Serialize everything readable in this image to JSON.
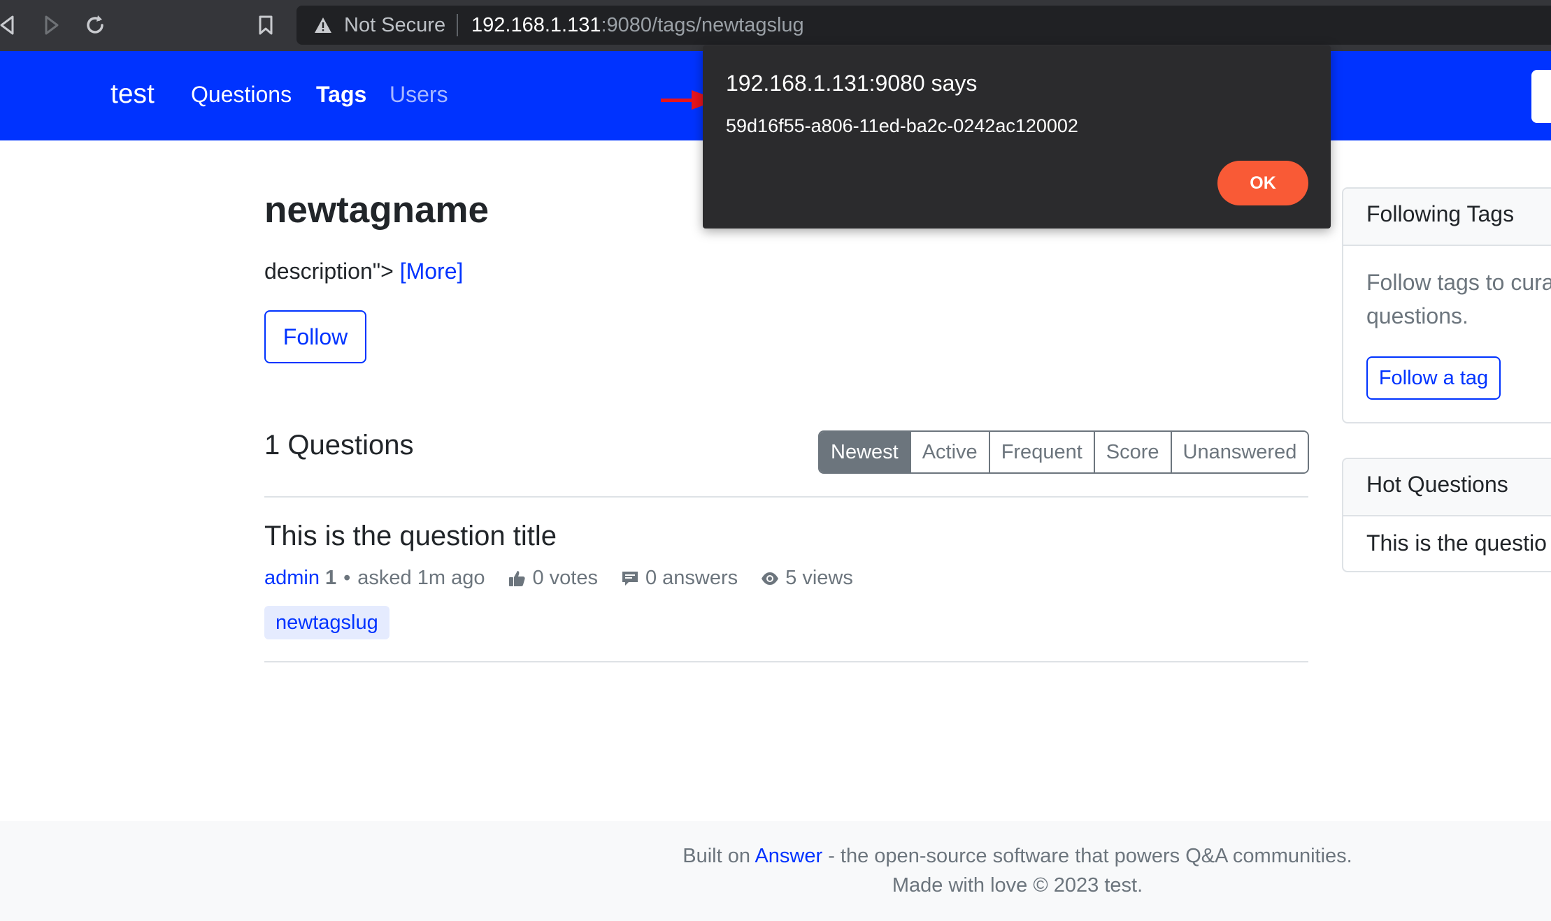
{
  "browser": {
    "security_label": "Not Secure",
    "url_host": "192.168.1.131",
    "url_path": ":9080/tags/newtagslug"
  },
  "navbar": {
    "brand": "test",
    "links": [
      "Questions",
      "Tags",
      "Users"
    ]
  },
  "tag": {
    "name": "newtagname",
    "description": "description\">",
    "more_label": "[More]",
    "follow_label": "Follow"
  },
  "questions": {
    "count_label": "1 Questions",
    "sort_options": [
      "Newest",
      "Active",
      "Frequent",
      "Score",
      "Unanswered"
    ],
    "active_sort": "Newest",
    "items": [
      {
        "title": "This is the question title",
        "author": "admin",
        "reputation": "1",
        "asked": "asked 1m ago",
        "votes": "0 votes",
        "answers": "0 answers",
        "views": "5 views",
        "tag": "newtagslug"
      }
    ]
  },
  "sidebar": {
    "following_tags": {
      "title": "Following Tags",
      "body_line1": "Follow tags to cura",
      "body_line2": "questions.",
      "button": "Follow a tag"
    },
    "hot_questions": {
      "title": "Hot Questions",
      "items": [
        "This is the questio"
      ]
    }
  },
  "footer": {
    "prefix": "Built on",
    "link": "Answer",
    "suffix": "- the open-source software that powers Q&A communities.",
    "line2": "Made with love © 2023 test."
  },
  "alert": {
    "title": "192.168.1.131:9080 says",
    "message": "59d16f55-a806-11ed-ba2c-0242ac120002",
    "ok_label": "OK"
  },
  "colors": {
    "navbar": "#0033ff",
    "accent": "#0033ff",
    "ok_button": "#f95a36",
    "annotation_arrow": "#e8141b"
  }
}
